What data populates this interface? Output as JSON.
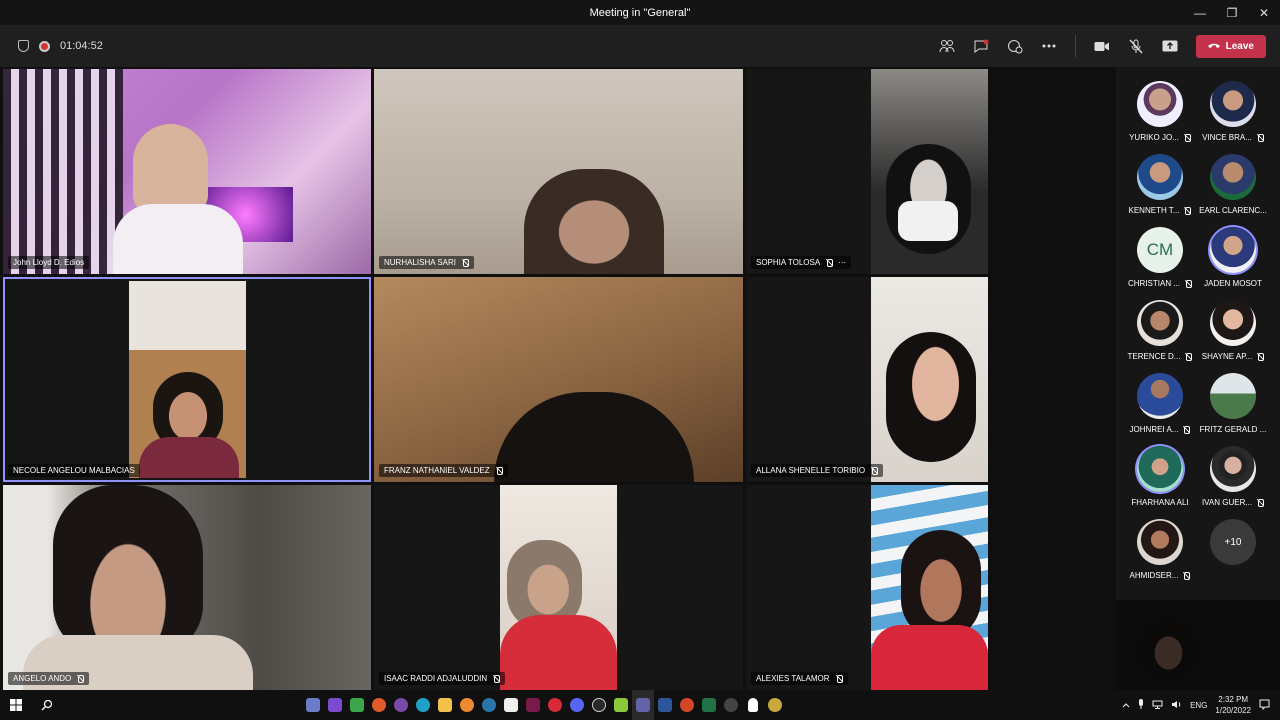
{
  "window": {
    "title": "Meeting in \"General\"",
    "min": "—",
    "max": "❐",
    "close": "✕"
  },
  "toolbar": {
    "duration": "01:04:52",
    "leave_label": "Leave"
  },
  "colors": {
    "accent": "#8f92ff",
    "leave": "#c4314b",
    "bg": "#0f0f0f"
  },
  "tiles": [
    {
      "name": "John Lloyd D. Edios",
      "muted": false
    },
    {
      "name": "NURHALISHA SARI",
      "muted": true
    },
    {
      "name": "SOPHIA TOLOSA",
      "muted": true,
      "more": "···"
    },
    {
      "name": "NECOLE ANGELOU MALBACIAS",
      "muted": false
    },
    {
      "name": "FRANZ NATHANIEL VALDEZ",
      "muted": true
    },
    {
      "name": "ALLANA SHENELLE TORIBIO",
      "muted": true
    },
    {
      "name": "ANGELO ANDO",
      "muted": true
    },
    {
      "name": "ISAAC RADDI ADJALUDDIN",
      "muted": true
    },
    {
      "name": "ALEXIES TALAMOR",
      "muted": true
    }
  ],
  "roster": [
    {
      "name": "YURIKO JO...",
      "muted": true
    },
    {
      "name": "VINCE BRA...",
      "muted": true
    },
    {
      "name": "KENNETH T...",
      "muted": true
    },
    {
      "name": "EARL CLARENC...",
      "muted": false
    },
    {
      "name": "CHRISTIAN ...",
      "muted": true,
      "initials": "CM"
    },
    {
      "name": "JADEN MOSOT",
      "muted": false
    },
    {
      "name": "TERENCE D...",
      "muted": true
    },
    {
      "name": "SHAYNE AP...",
      "muted": true
    },
    {
      "name": "JOHNREI A...",
      "muted": true
    },
    {
      "name": "FRITZ GERALD ...",
      "muted": false
    },
    {
      "name": "FHARHANA ALI",
      "muted": false
    },
    {
      "name": "IVAN GUER...",
      "muted": true
    },
    {
      "name": "AHMIDSER...",
      "muted": true
    },
    {
      "overflow": "+10"
    }
  ],
  "taskbar": {
    "lang": "ENG",
    "time": "2:32 PM",
    "date": "1/20/2022"
  }
}
